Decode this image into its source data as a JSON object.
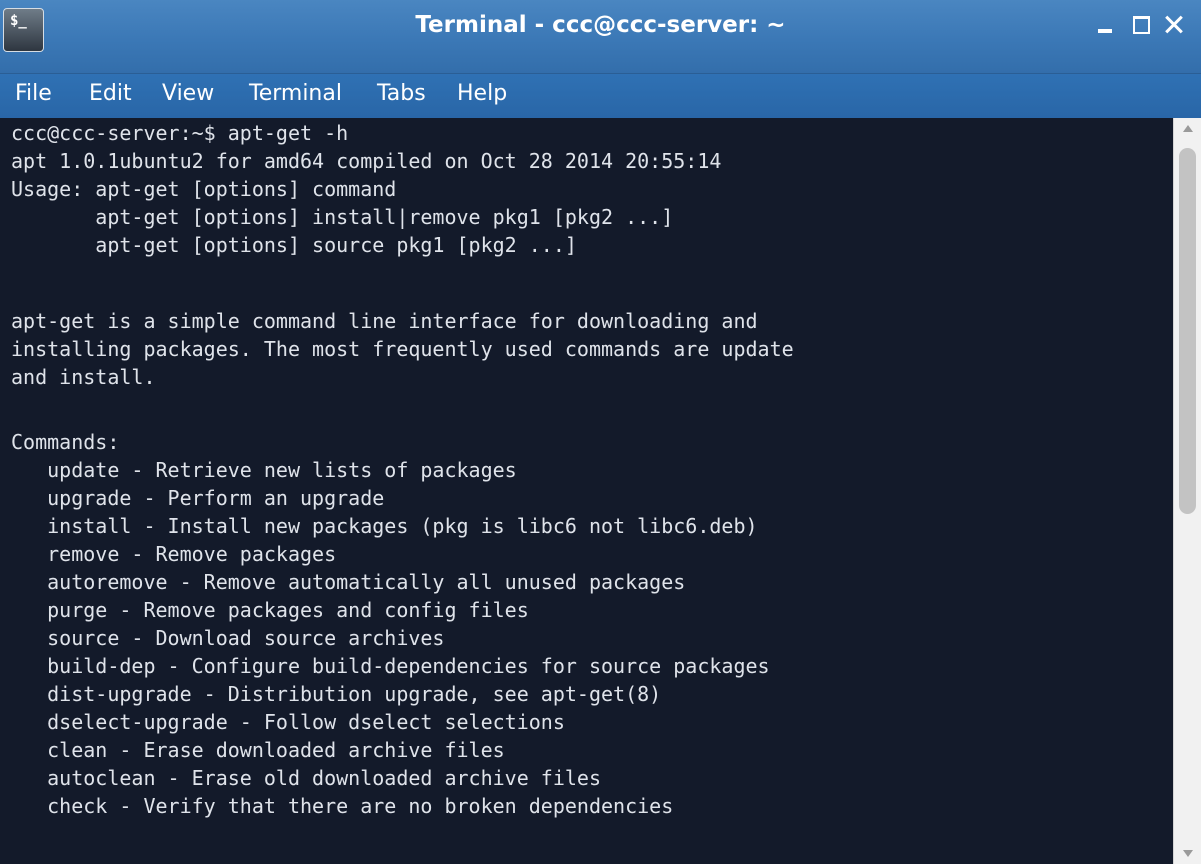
{
  "window": {
    "title": "Terminal - ccc@ccc-server: ~",
    "icon": "terminal-icon",
    "icon_glyph": "$_",
    "controls": [
      "minimize-icon",
      "maximize-icon",
      "close-icon"
    ]
  },
  "menubar": {
    "items": [
      {
        "label": "File"
      },
      {
        "label": "Edit"
      },
      {
        "label": "View"
      },
      {
        "label": "Terminal"
      },
      {
        "label": "Tabs"
      },
      {
        "label": "Help"
      }
    ]
  },
  "terminal": {
    "lines": [
      "ccc@ccc-server:~$ apt-get -h",
      "apt 1.0.1ubuntu2 for amd64 compiled on Oct 28 2014 20:55:14",
      "Usage: apt-get [options] command",
      "       apt-get [options] install|remove pkg1 [pkg2 ...]",
      "       apt-get [options] source pkg1 [pkg2 ...]",
      "",
      "apt-get is a simple command line interface for downloading and",
      "installing packages. The most frequently used commands are update",
      "and install.",
      "",
      "Commands:",
      "   update - Retrieve new lists of packages",
      "   upgrade - Perform an upgrade",
      "   install - Install new packages (pkg is libc6 not libc6.deb)",
      "   remove - Remove packages",
      "   autoremove - Remove automatically all unused packages",
      "   purge - Remove packages and config files",
      "   source - Download source archives",
      "   build-dep - Configure build-dependencies for source packages",
      "   dist-upgrade - Distribution upgrade, see apt-get(8)",
      "   dselect-upgrade - Follow dselect selections",
      "   clean - Erase downloaded archive files",
      "   autoclean - Erase old downloaded archive files",
      "   check - Verify that there are no broken dependencies"
    ]
  },
  "colors": {
    "titlebar": "#3b78b6",
    "menubar": "#2d6db0",
    "terminal_bg": "#131a2a",
    "terminal_fg": "#dfe3ea"
  }
}
